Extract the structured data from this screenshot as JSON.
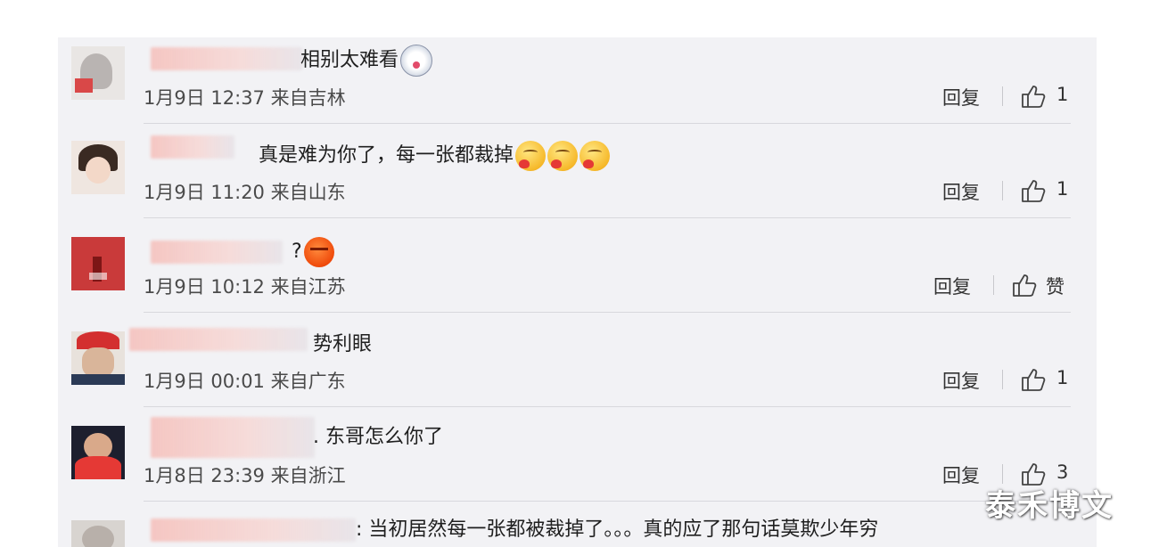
{
  "comments": [
    {
      "text": "相别太难看",
      "emojis": [
        "dog-face-emoji"
      ],
      "meta": "1月9日 12:37 来自吉林",
      "reply_label": "回复",
      "like_count": "1"
    },
    {
      "text": "真是难为你了，每一张都裁掉",
      "emojis": [
        "kiss-face-emoji",
        "kiss-face-emoji",
        "kiss-face-emoji"
      ],
      "meta": "1月9日 11:20 来自山东",
      "reply_label": "回复",
      "like_count": "1"
    },
    {
      "text": "?",
      "emojis": [
        "angry-face-emoji"
      ],
      "meta": "1月9日 10:12 来自江苏",
      "reply_label": "回复",
      "like_count": "赞"
    },
    {
      "text": "势利眼",
      "emojis": [],
      "meta": "1月9日 00:01 来自广东",
      "reply_label": "回复",
      "like_count": "1"
    },
    {
      "text": ". 东哥怎么你了",
      "emojis": [],
      "meta": "1月8日 23:39 来自浙江",
      "reply_label": "回复",
      "like_count": "3"
    },
    {
      "text": ": 当初居然每一张都被裁掉了。。。真的应了那句话莫欺少年穷",
      "emojis": [],
      "meta": "",
      "reply_label": "",
      "like_count": ""
    }
  ],
  "watermark": "泰禾博文",
  "colors": {
    "panel_bg": "#f2f2f5",
    "text": "#1f1f1f",
    "meta": "#4a4a4a",
    "divider": "#d8d8dd"
  },
  "icons": {
    "like": "thumbs-up-icon"
  }
}
